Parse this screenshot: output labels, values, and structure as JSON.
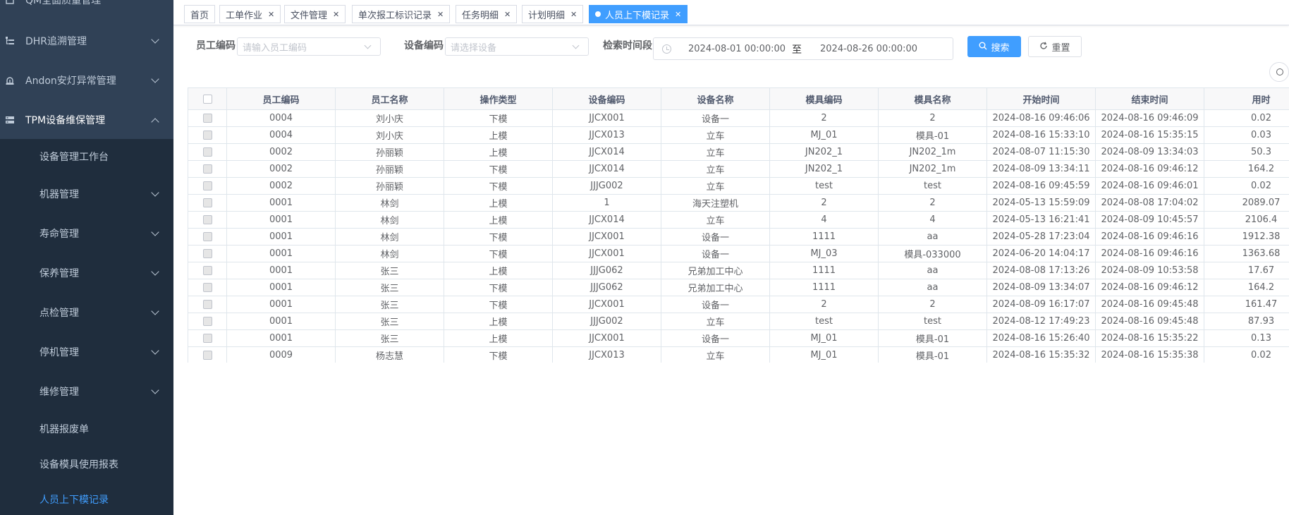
{
  "sidebar": {
    "top_partial": "QM全面质量管理",
    "menus": [
      {
        "label": "DHR追溯管理",
        "icon": "tree-icon"
      },
      {
        "label": "Andon安灯异常管理",
        "icon": "alarm-light-icon"
      },
      {
        "label": "TPM设备维保管理",
        "icon": "server-icon"
      }
    ],
    "submenus": [
      {
        "label": "设备管理工作台",
        "arrow": false
      },
      {
        "label": "机器管理",
        "arrow": true
      },
      {
        "label": "寿命管理",
        "arrow": true
      },
      {
        "label": "保养管理",
        "arrow": true
      },
      {
        "label": "点检管理",
        "arrow": true
      },
      {
        "label": "停机管理",
        "arrow": true
      },
      {
        "label": "维修管理",
        "arrow": true
      },
      {
        "label": "机器报废单",
        "arrow": false
      },
      {
        "label": "设备模具使用报表",
        "arrow": false
      },
      {
        "label": "人员上下模记录",
        "arrow": false,
        "active": true
      }
    ]
  },
  "tags": [
    {
      "label": "首页",
      "closable": false
    },
    {
      "label": "工单作业",
      "closable": true
    },
    {
      "label": "文件管理",
      "closable": true
    },
    {
      "label": "单次报工标识记录",
      "closable": true
    },
    {
      "label": "任务明细",
      "closable": true
    },
    {
      "label": "计划明细",
      "closable": true
    },
    {
      "label": "人员上下模记录",
      "closable": true,
      "active": true
    }
  ],
  "search": {
    "employee_label": "员工编码",
    "employee_placeholder": "请输入员工编码",
    "device_label": "设备编码",
    "device_placeholder": "请选择设备",
    "time_label": "检索时间段",
    "start_date": "2024-08-01 00:00:00",
    "range_sep": "至",
    "end_date": "2024-08-26 00:00:00",
    "search_btn": "搜索",
    "reset_btn": "重置"
  },
  "colors": {
    "sidebar_bg": "#304156",
    "submenu_bg": "#1f2d3d",
    "primary": "#409eff"
  },
  "table": {
    "headers": [
      "员工编码",
      "员工名称",
      "操作类型",
      "设备编码",
      "设备名称",
      "模具编码",
      "模具名称",
      "开始时间",
      "结束时间",
      "用时"
    ],
    "rows": [
      [
        "0004",
        "刘小庆",
        "下模",
        "JJCX001",
        "设备一",
        "2",
        "2",
        "2024-08-16 09:46:06",
        "2024-08-16 09:46:09",
        "0.02"
      ],
      [
        "0004",
        "刘小庆",
        "上模",
        "JJCX013",
        "立车",
        "MJ_01",
        "模具-01",
        "2024-08-16 15:33:10",
        "2024-08-16 15:35:15",
        "0.03"
      ],
      [
        "0002",
        "孙丽颖",
        "上模",
        "JJCX014",
        "立车",
        "JN202_1",
        "JN202_1m",
        "2024-08-07 11:15:30",
        "2024-08-09 13:34:03",
        "50.3"
      ],
      [
        "0002",
        "孙丽颖",
        "下模",
        "JJCX014",
        "立车",
        "JN202_1",
        "JN202_1m",
        "2024-08-09 13:34:11",
        "2024-08-16 09:46:12",
        "164.2"
      ],
      [
        "0002",
        "孙丽颖",
        "下模",
        "JJJG002",
        "立车",
        "test",
        "test",
        "2024-08-16 09:45:59",
        "2024-08-16 09:46:01",
        "0.02"
      ],
      [
        "0001",
        "林剑",
        "上模",
        "1",
        "海天注塑机",
        "2",
        "2",
        "2024-05-13 15:59:09",
        "2024-08-08 17:04:02",
        "2089.07"
      ],
      [
        "0001",
        "林剑",
        "上模",
        "JJCX014",
        "立车",
        "4",
        "4",
        "2024-05-13 16:21:41",
        "2024-08-09 10:45:57",
        "2106.4"
      ],
      [
        "0001",
        "林剑",
        "下模",
        "JJCX001",
        "设备一",
        "1111",
        "aa",
        "2024-05-28 17:23:04",
        "2024-08-16 09:46:16",
        "1912.38"
      ],
      [
        "0001",
        "林剑",
        "下模",
        "JJCX001",
        "设备一",
        "MJ_03",
        "模具-033000",
        "2024-06-20 14:04:17",
        "2024-08-16 09:46:16",
        "1363.68"
      ],
      [
        "0001",
        "张三",
        "上模",
        "JJJG062",
        "兄弟加工中心",
        "1111",
        "aa",
        "2024-08-08 17:13:26",
        "2024-08-09 10:53:58",
        "17.67"
      ],
      [
        "0001",
        "张三",
        "下模",
        "JJJG062",
        "兄弟加工中心",
        "1111",
        "aa",
        "2024-08-09 13:34:07",
        "2024-08-16 09:46:12",
        "164.2"
      ],
      [
        "0001",
        "张三",
        "下模",
        "JJCX001",
        "设备一",
        "2",
        "2",
        "2024-08-09 16:17:07",
        "2024-08-16 09:45:48",
        "161.47"
      ],
      [
        "0001",
        "张三",
        "上模",
        "JJJG002",
        "立车",
        "test",
        "test",
        "2024-08-12 17:49:23",
        "2024-08-16 09:45:48",
        "87.93"
      ],
      [
        "0001",
        "张三",
        "上模",
        "JJCX001",
        "设备一",
        "MJ_01",
        "模具-01",
        "2024-08-16 15:26:40",
        "2024-08-16 15:35:22",
        "0.13"
      ],
      [
        "0009",
        "杨志慧",
        "下模",
        "JJCX013",
        "立车",
        "MJ_01",
        "模具-01",
        "2024-08-16 15:35:32",
        "2024-08-16 15:35:38",
        "0.02"
      ]
    ]
  }
}
